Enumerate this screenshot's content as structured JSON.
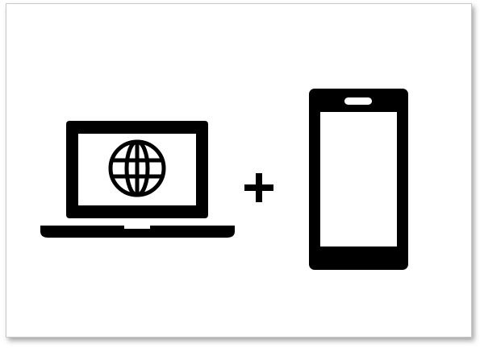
{
  "icons": {
    "laptop": "laptop-with-globe-icon",
    "globe": "globe-icon",
    "plus": "plus-icon",
    "phone": "smartphone-icon"
  },
  "colors": {
    "ink": "#000000",
    "background": "#ffffff",
    "frame_border": "#c8c8c8"
  }
}
